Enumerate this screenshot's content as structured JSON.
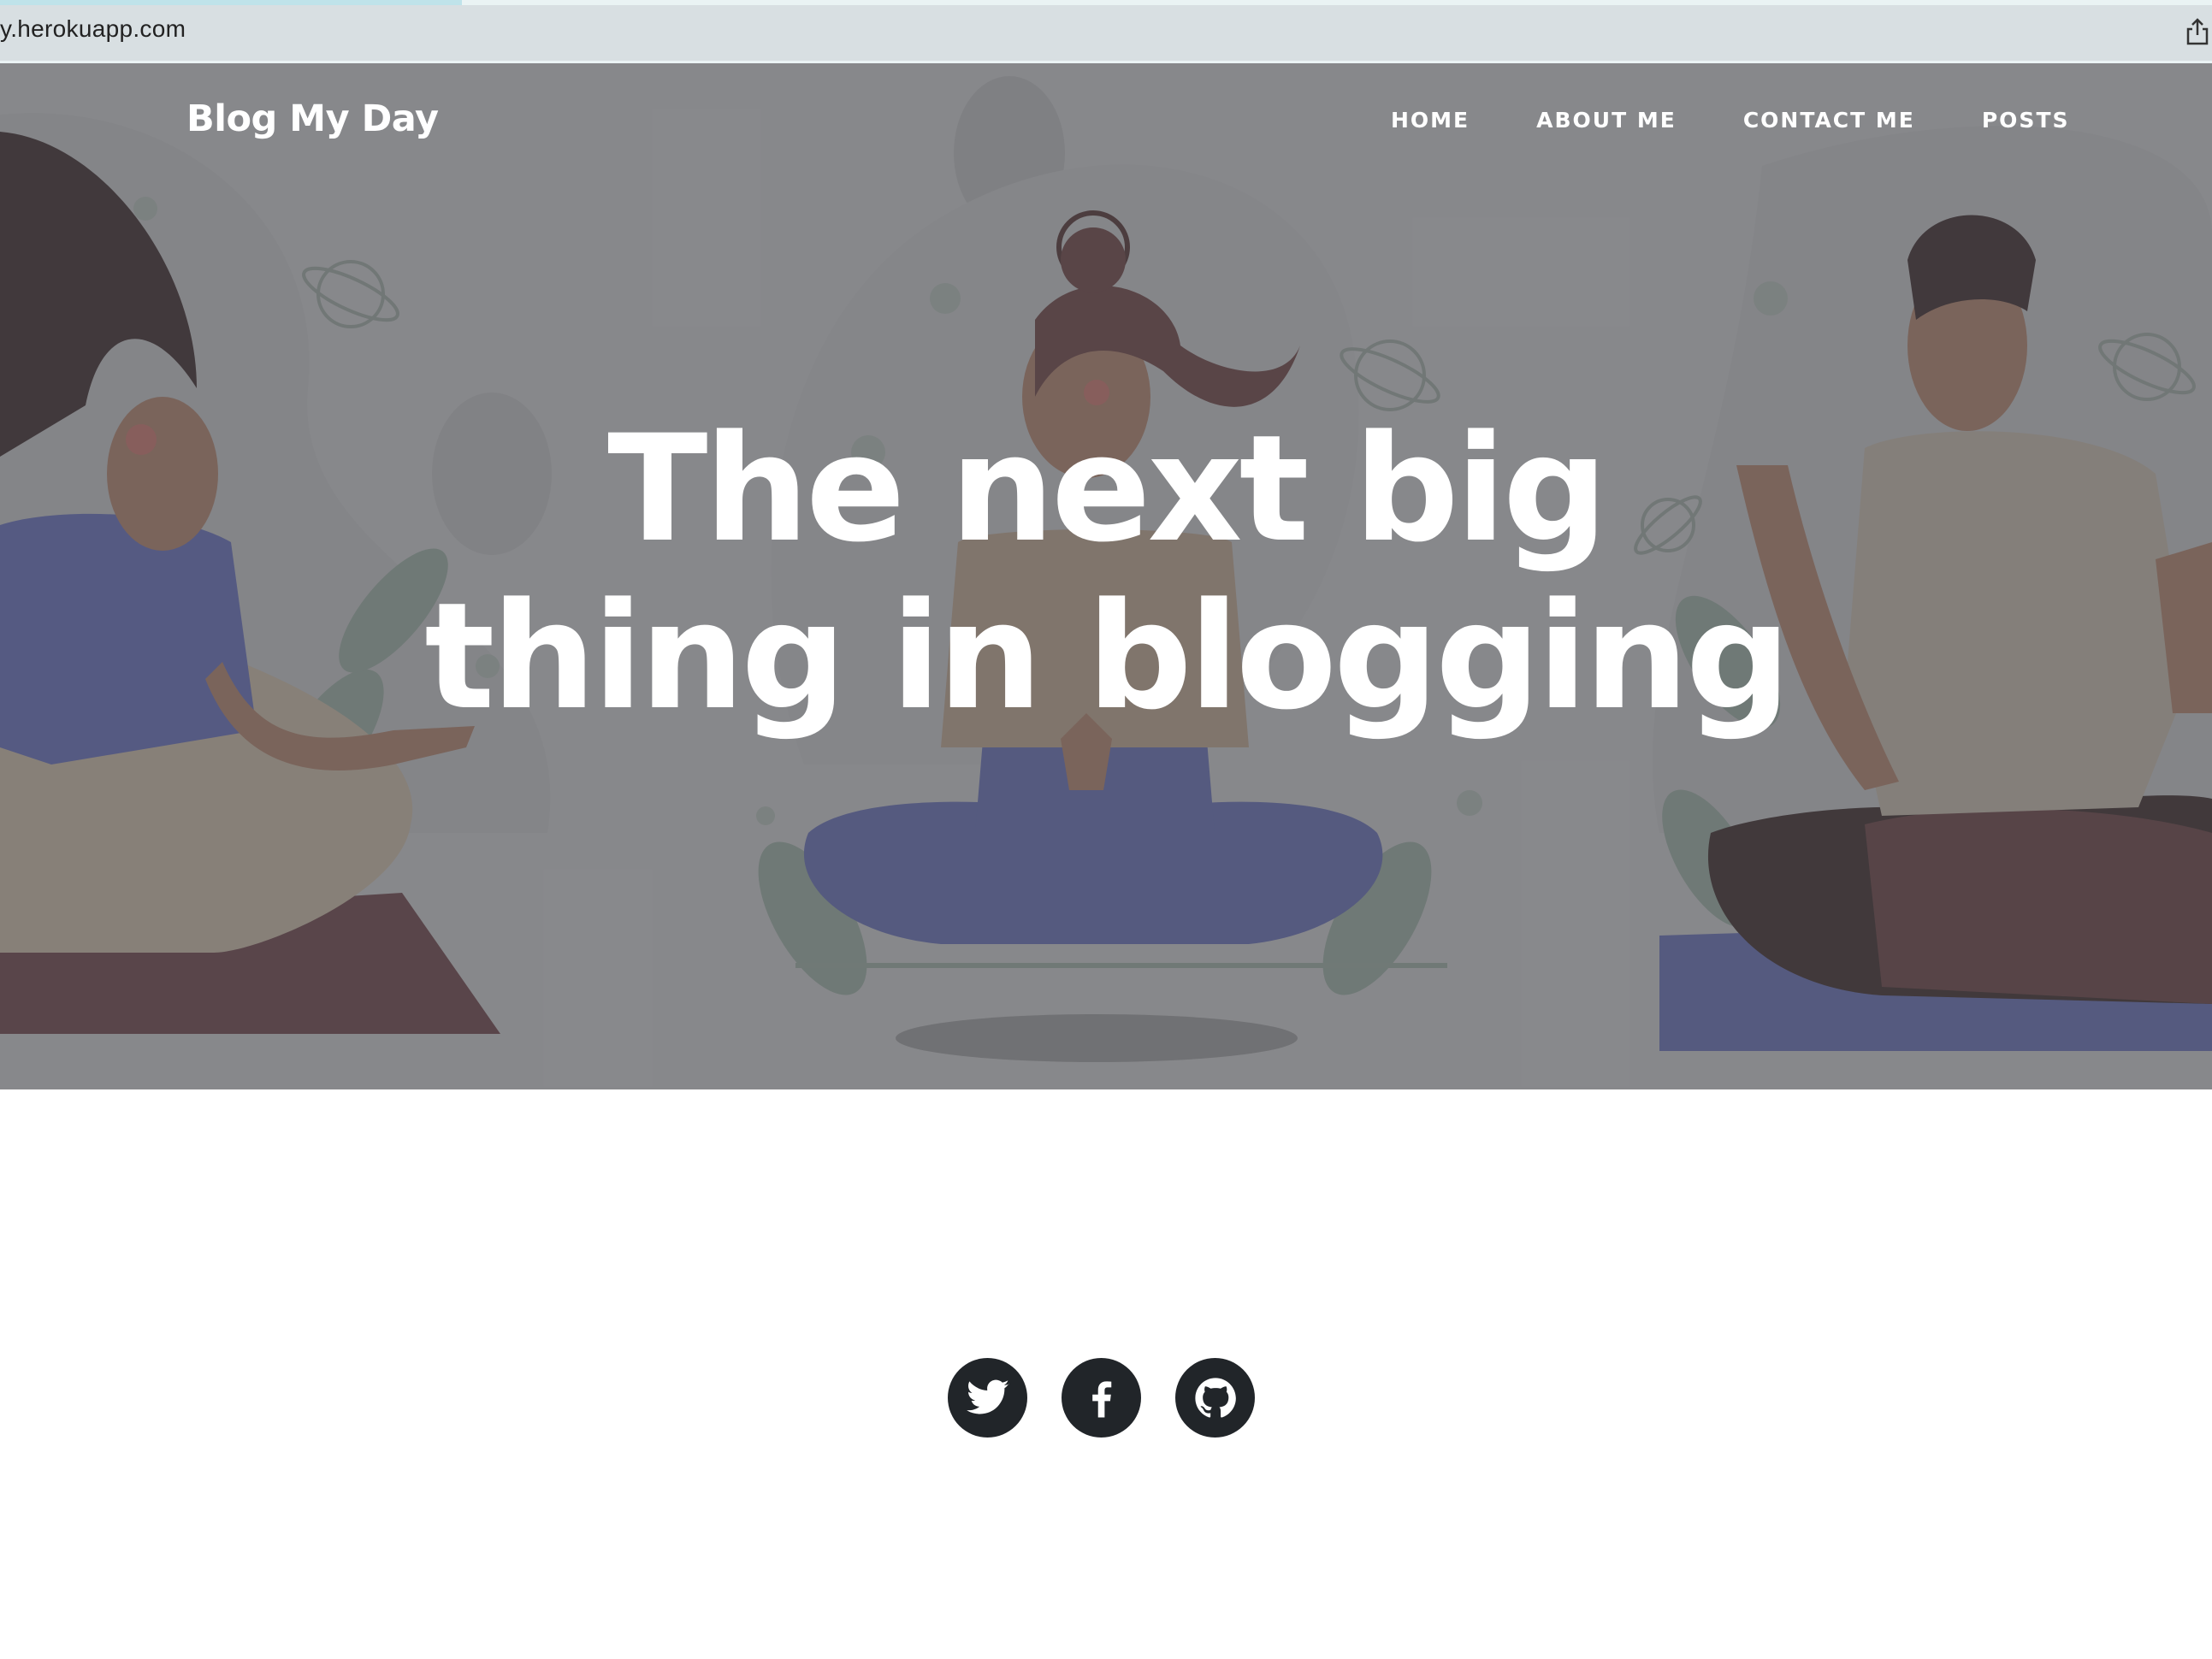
{
  "browser": {
    "url": "y.herokuapp.com"
  },
  "site": {
    "brand": "Blog My Day",
    "nav": [
      "HOME",
      "ABOUT ME",
      "CONTACT ME",
      "POSTS"
    ]
  },
  "hero": {
    "headline_line1": "The next big",
    "headline_line2": "thing in blogging"
  },
  "footer": {
    "social_icons": [
      "twitter-icon",
      "facebook-icon",
      "github-icon"
    ]
  },
  "colors": {
    "hero_overlay": "#8f9093",
    "social_bg": "#212529"
  }
}
